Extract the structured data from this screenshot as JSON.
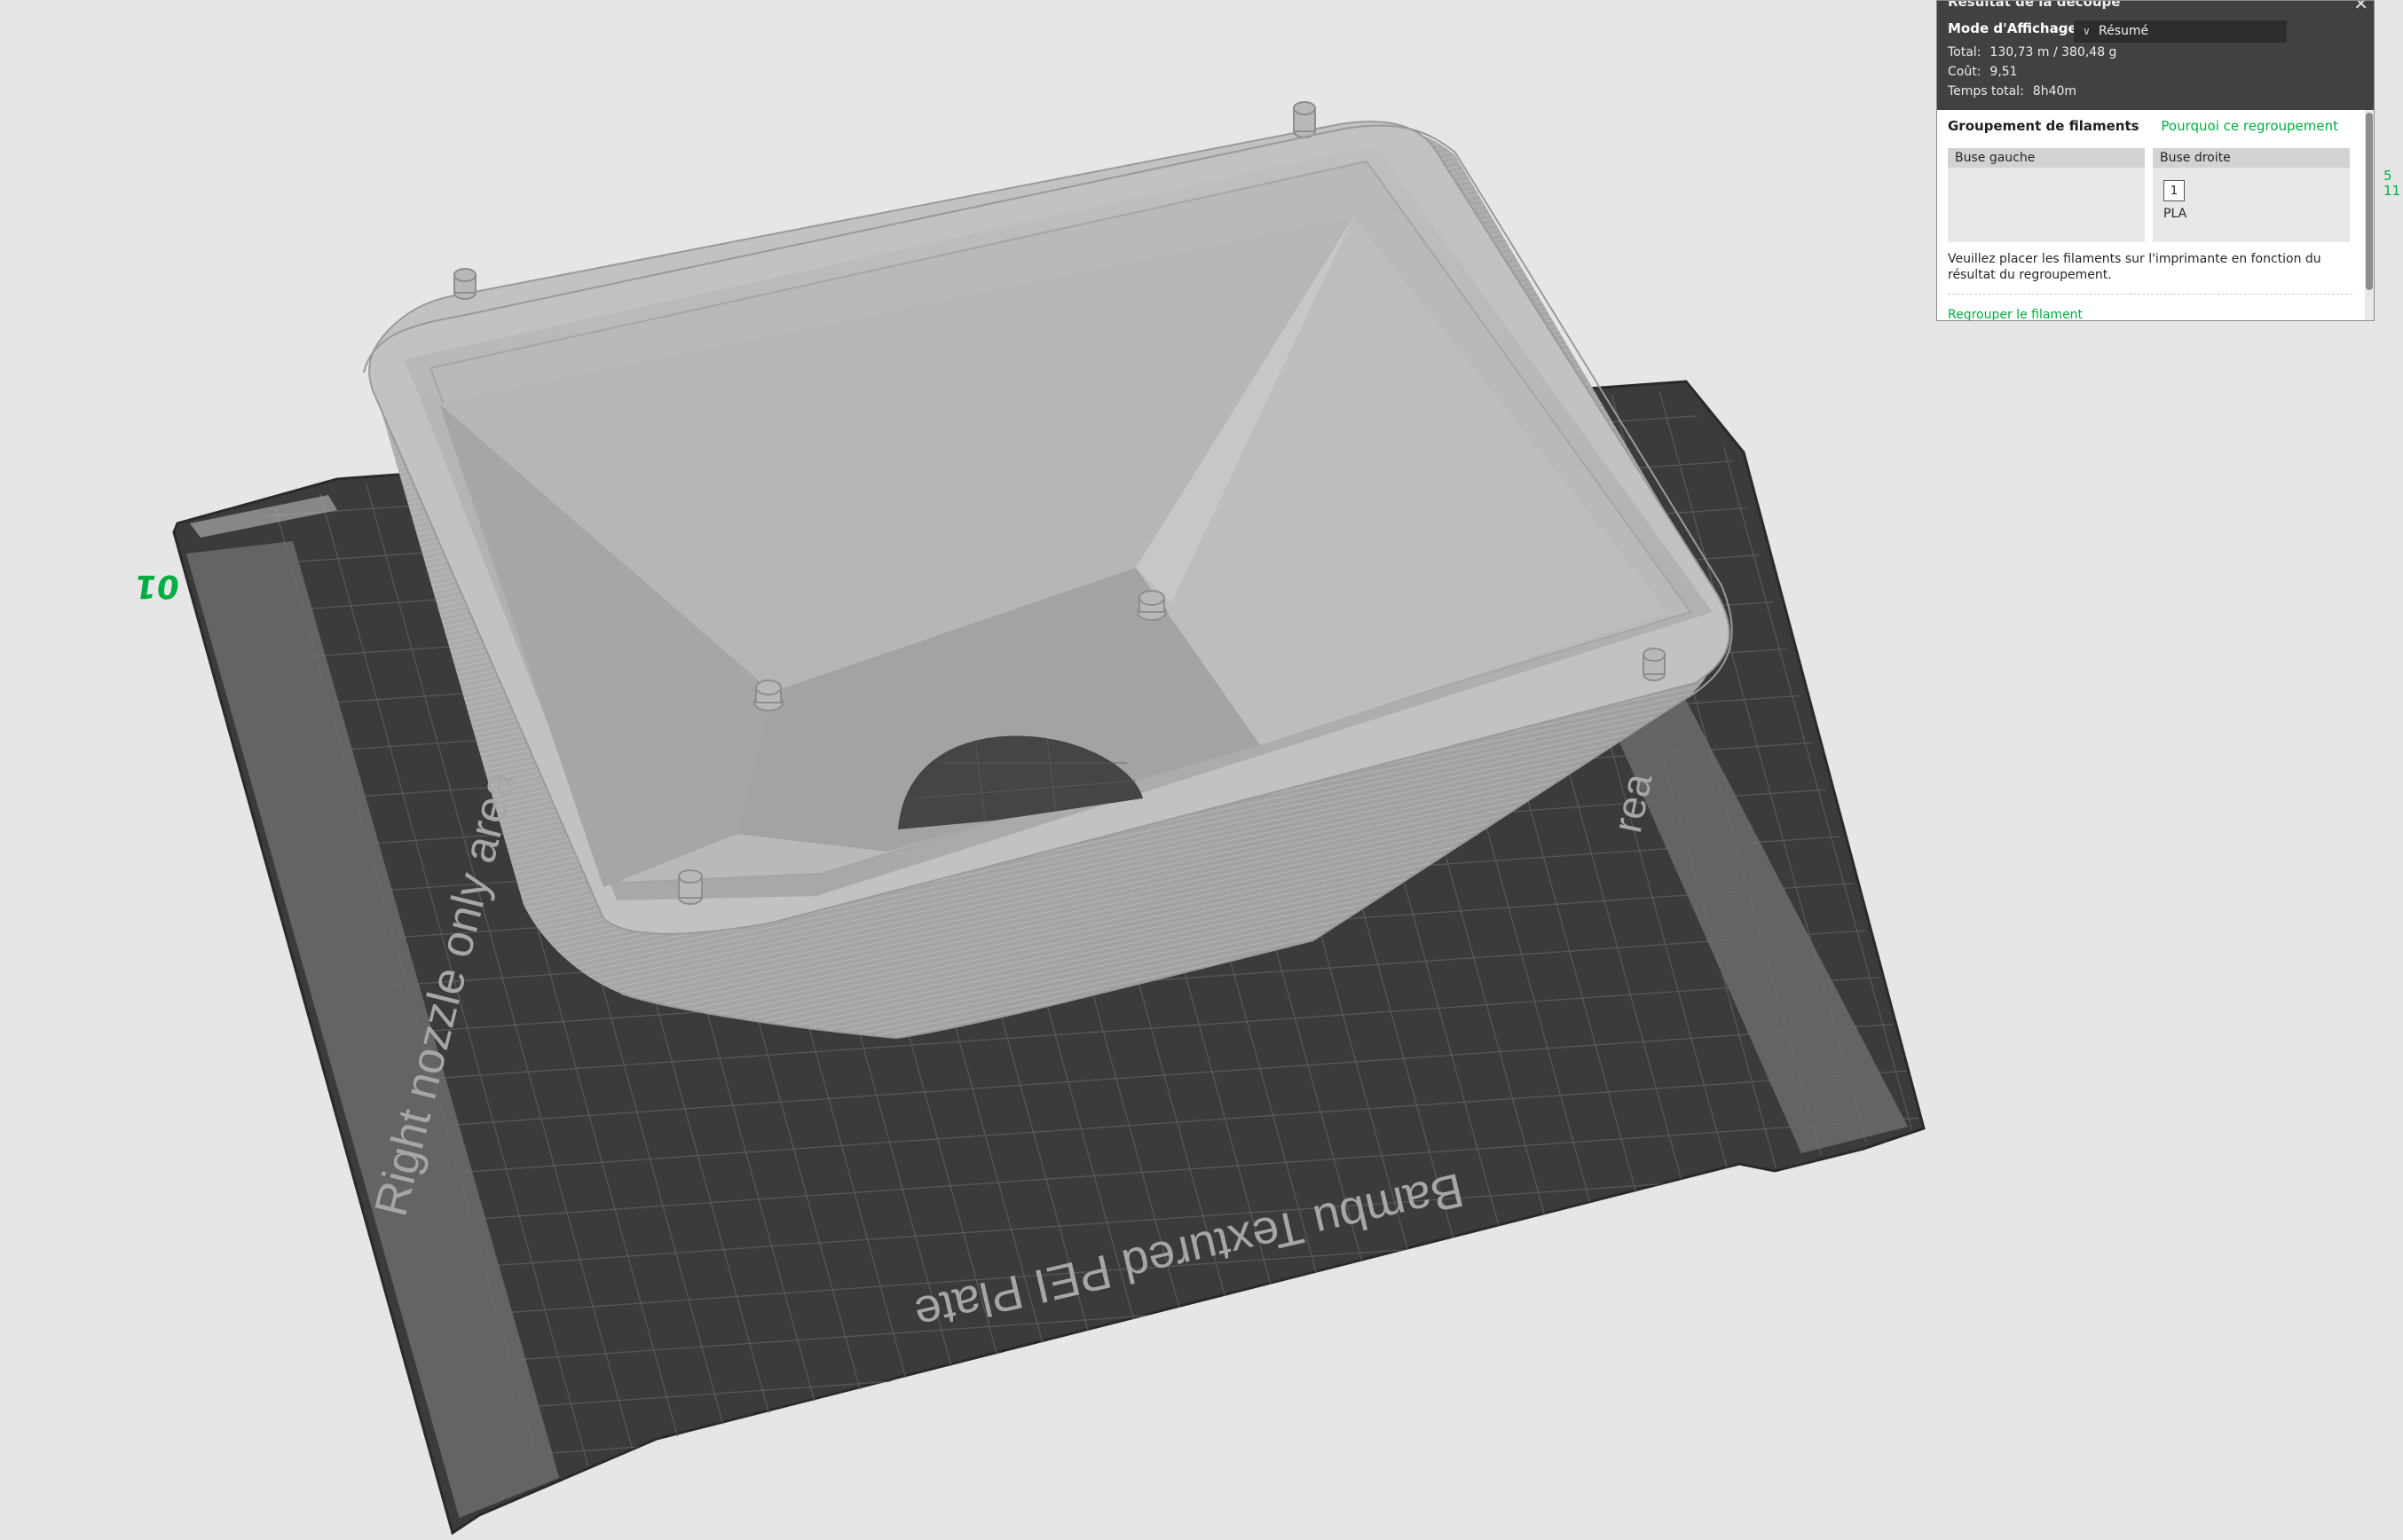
{
  "plate": {
    "plate_number": "01",
    "left_zone_label": "Right nozzle only area",
    "right_zone_label_visible": "rea",
    "brand_label": "Bambu Textured PEI Plate"
  },
  "result_panel": {
    "title": "Résultat de la découpe",
    "close_icon": "close-icon",
    "display_mode_label": "Mode d'Affichage",
    "display_mode_value": "Résumé",
    "stats": [
      {
        "label": "Total:",
        "value": "130,73 m / 380,48 g"
      },
      {
        "label": "Coût:",
        "value": "9,51"
      },
      {
        "label": "Temps total:",
        "value": "8h40m"
      }
    ],
    "grouping": {
      "header": "Groupement de filaments",
      "why_link": "Pourquoi ce regroupement",
      "left_nozzle": "Buse gauche",
      "right_nozzle": "Buse droite",
      "filament_slot": "1",
      "filament_type": "PLA",
      "hint": "Veuillez placer les filaments sur l'imprimante en fonction du résultat du regroupement.",
      "regroup_link": "Regrouper le filament"
    }
  },
  "layer_indicator": {
    "top": "5",
    "bottom": "11"
  },
  "colors": {
    "background": "#e6e6e6",
    "plate": "#3b3b3b",
    "model": "#a9a9a9",
    "accent": "#00ae42",
    "panel_dark": "#414141"
  }
}
